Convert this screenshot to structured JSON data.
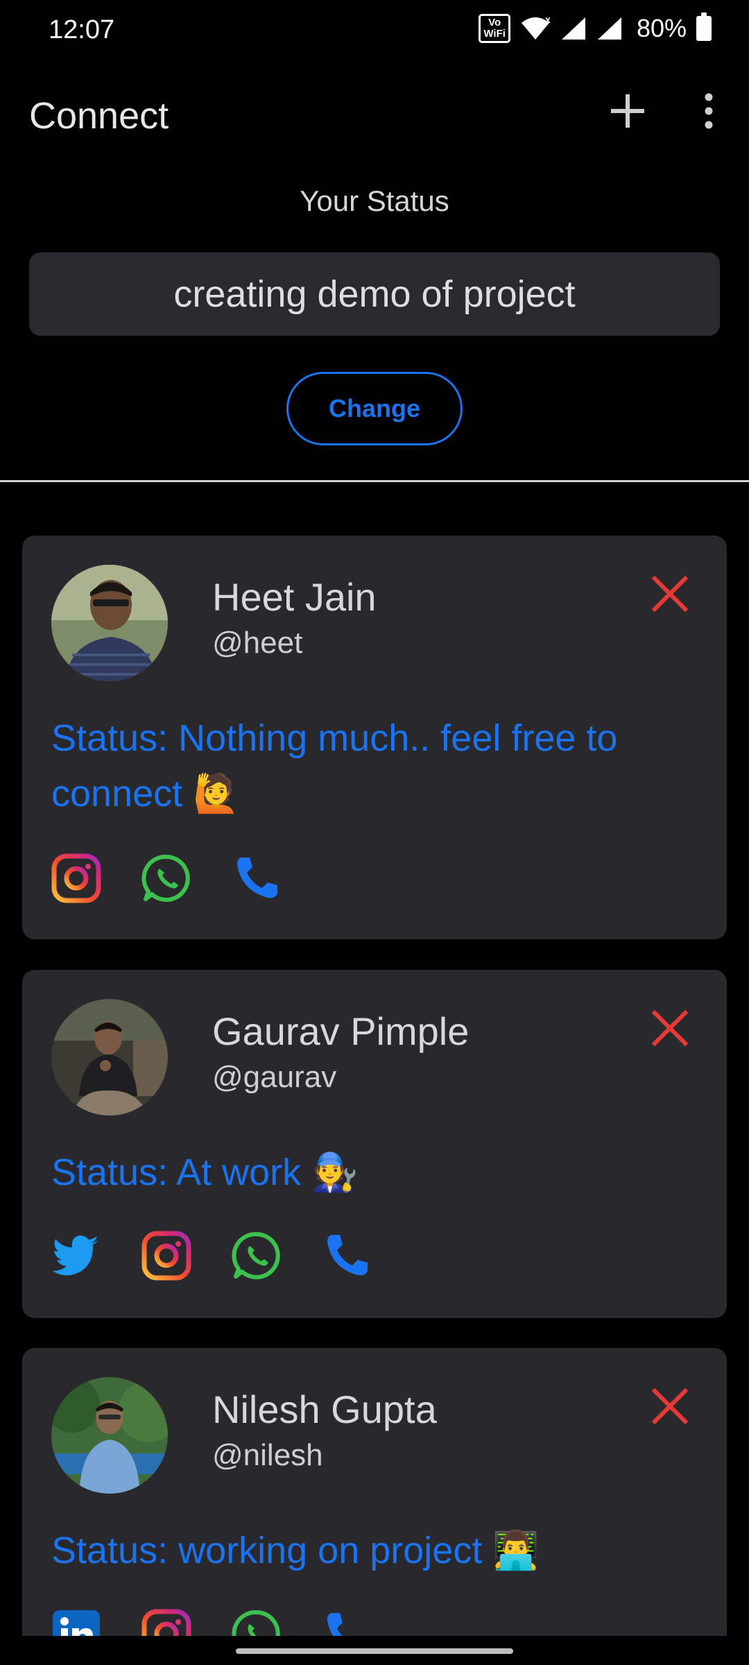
{
  "status_bar": {
    "time": "12:07",
    "vowifi_top": "Vo",
    "vowifi_bottom": "WiFi",
    "battery": "80%"
  },
  "app_bar": {
    "title": "Connect"
  },
  "your_status": {
    "label": "Your Status",
    "value": "creating demo of project",
    "change_label": "Change"
  },
  "contacts": [
    {
      "name": "Heet Jain",
      "handle": "@heet",
      "status": "Status: Nothing much.. feel free to connect 🙋",
      "socials": [
        "instagram-icon",
        "whatsapp-icon",
        "phone-icon"
      ]
    },
    {
      "name": "Gaurav Pimple",
      "handle": "@gaurav",
      "status": "Status: At work 🧑‍🔧",
      "socials": [
        "twitter-icon",
        "instagram-icon",
        "whatsapp-icon",
        "phone-icon"
      ]
    },
    {
      "name": "Nilesh Gupta",
      "handle": "@nilesh",
      "status": "Status: working on project 👨‍💻",
      "socials": [
        "linkedin-icon",
        "instagram-icon",
        "whatsapp-icon",
        "phone-icon"
      ]
    }
  ],
  "colors": {
    "background": "#000000",
    "card": "#29292d",
    "accent": "#1a73f0",
    "close": "#e53935",
    "whatsapp": "#3cc14e",
    "twitter": "#1d9bf0",
    "linkedin": "#0a66c2"
  }
}
